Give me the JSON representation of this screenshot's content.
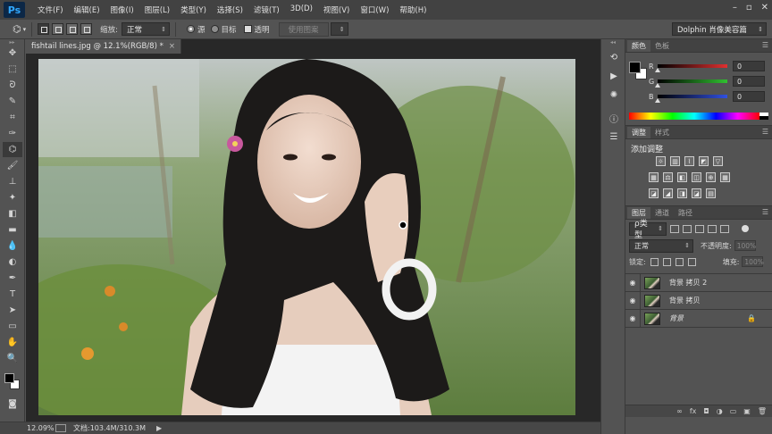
{
  "app": {
    "logo": "Ps"
  },
  "menu": [
    "文件(F)",
    "编辑(E)",
    "图像(I)",
    "图层(L)",
    "类型(Y)",
    "选择(S)",
    "滤镜(T)",
    "3D(D)",
    "视图(V)",
    "窗口(W)",
    "帮助(H)"
  ],
  "window_controls": {
    "minimize": "–",
    "maximize": "▫",
    "close": "✕"
  },
  "options_bar": {
    "tool_icon": "brush-preset-icon",
    "zoom_label": "缩放:",
    "mode_value": "正常",
    "source_label": "源",
    "target_label": "目标",
    "transparent_label": "透明",
    "use_pattern_label": "使用图案",
    "preset": "Dolphin 肖像美容篇"
  },
  "tools": [
    "move-tool-icon",
    "marquee-tool-icon",
    "lasso-tool-icon",
    "quick-select-tool-icon",
    "crop-tool-icon",
    "eyedropper-tool-icon",
    "patch-tool-icon",
    "brush-tool-icon",
    "clone-stamp-tool-icon",
    "history-brush-tool-icon",
    "eraser-tool-icon",
    "gradient-tool-icon",
    "blur-tool-icon",
    "dodge-tool-icon",
    "pen-tool-icon",
    "type-tool-icon",
    "path-select-tool-icon",
    "rectangle-tool-icon",
    "hand-tool-icon",
    "zoom-tool-icon"
  ],
  "tool_glyphs": [
    "✥",
    "⬚",
    "ᘐ",
    "✎",
    "⌗",
    "✑",
    "⌬",
    "🖌",
    "⊥",
    "✦",
    "◧",
    "▬",
    "💧",
    "◐",
    "✒",
    "T",
    "➤",
    "▭",
    "✋",
    "🔍"
  ],
  "active_tool_index": 6,
  "document": {
    "tab_title": "fishtail lines.jpg @ 12.1%(RGB/8) *",
    "close": "×"
  },
  "status": {
    "zoom": "12.09%",
    "doc_size": "文档:103.4M/310.3M",
    "arrow": "▶"
  },
  "panel_strip": [
    "history-icon",
    "actions-icon",
    "brush-presets-icon",
    "info-icon",
    "properties-icon"
  ],
  "color_panel": {
    "tabs": [
      "颜色",
      "色板"
    ],
    "rgb": [
      {
        "label": "R",
        "value": "0",
        "color": "#e03030"
      },
      {
        "label": "G",
        "value": "0",
        "color": "#30c030"
      },
      {
        "label": "B",
        "value": "0",
        "color": "#3050e0"
      }
    ]
  },
  "adjustments_panel": {
    "tabs": [
      "调整",
      "样式"
    ],
    "title": "添加调整",
    "rows": [
      [
        "brightness-icon",
        "levels-icon",
        "curves-icon",
        "exposure-icon",
        "vibrance-icon"
      ],
      [
        "hue-icon",
        "balance-icon",
        "bw-icon",
        "photo-filter-icon",
        "mixer-icon",
        "lookup-icon"
      ],
      [
        "invert-icon",
        "posterize-icon",
        "threshold-icon",
        "selective-color-icon",
        "gradient-map-icon"
      ]
    ]
  },
  "layers_panel": {
    "tabs": [
      "图层",
      "通道",
      "路径"
    ],
    "kind_filter": "ρ类型",
    "blend_mode": "正常",
    "opacity_label": "不透明度:",
    "opacity_value": "100%",
    "lock_label": "锁定:",
    "fill_label": "填充:",
    "fill_value": "100%",
    "layers": [
      {
        "name": "背景 拷贝 2",
        "italic": false,
        "locked": false
      },
      {
        "name": "背景 拷贝",
        "italic": false,
        "locked": false
      },
      {
        "name": "背景",
        "italic": true,
        "locked": true
      }
    ],
    "footer": [
      "∞",
      "fx",
      "◘",
      "◑",
      "▭",
      "▣",
      "🗑"
    ]
  },
  "colors": {
    "accent": "#31a8ff",
    "panel_bg": "#535353",
    "menubar_bg": "#424242"
  }
}
